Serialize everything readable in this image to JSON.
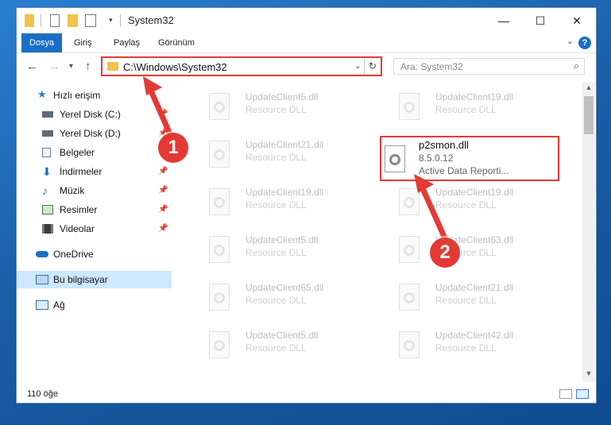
{
  "window": {
    "title": "System32",
    "controls": {
      "minimize": "—",
      "maximize": "☐",
      "close": "✕"
    }
  },
  "ribbon": {
    "tabs": [
      "Dosya",
      "Giriş",
      "Paylaş",
      "Görünüm"
    ],
    "active_tab": "Dosya",
    "help": "?"
  },
  "address": {
    "path": "C:\\Windows\\System32",
    "search_placeholder": "Ara: System32"
  },
  "nav": {
    "items": [
      {
        "label": "Hızlı erişim",
        "icon": "star-icon",
        "pinned": false
      },
      {
        "label": "Yerel Disk (C:)",
        "icon": "drive-icon",
        "pinned": true
      },
      {
        "label": "Yerel Disk (D:)",
        "icon": "drive-icon",
        "pinned": true
      },
      {
        "label": "Belgeler",
        "icon": "documents-icon",
        "pinned": true
      },
      {
        "label": "İndirmeler",
        "icon": "download-icon",
        "pinned": true
      },
      {
        "label": "Müzik",
        "icon": "music-icon",
        "pinned": true
      },
      {
        "label": "Resimler",
        "icon": "pictures-icon",
        "pinned": true
      },
      {
        "label": "Videolar",
        "icon": "videos-icon",
        "pinned": true
      },
      {
        "label": "OneDrive",
        "icon": "onedrive-icon",
        "pinned": false
      },
      {
        "label": "Bu bilgisayar",
        "icon": "computer-icon",
        "pinned": false,
        "selected": true
      },
      {
        "label": "Ağ",
        "icon": "network-icon",
        "pinned": false
      }
    ]
  },
  "files": {
    "left": [
      {
        "name": "UpdateClient5.dll",
        "desc": "Resource DLL"
      },
      {
        "name": "UpdateClient21.dll",
        "desc": "Resource DLL"
      },
      {
        "name": "UpdateClient19.dll",
        "desc": "Resource DLL"
      },
      {
        "name": "UpdateClient5.dll",
        "desc": "Resource DLL"
      },
      {
        "name": "UpdateClient65.dll",
        "desc": "Resource DLL"
      },
      {
        "name": "UpdateClient5.dll",
        "desc": "Resource DLL"
      }
    ],
    "right": [
      {
        "name": "UpdateClient19.dll",
        "desc": "Resource DLL"
      },
      null,
      {
        "name": "UpdateClient19.dll",
        "desc": "Resource DLL"
      },
      {
        "name": "UpdateClient63.dll",
        "desc": "Resource DLL"
      },
      {
        "name": "UpdateClient21.dll",
        "desc": "Resource DLL"
      },
      {
        "name": "UpdateClient42.dll",
        "desc": "Resource DLL"
      }
    ],
    "highlighted": {
      "name": "p2smon.dll",
      "version": "8.5.0.12",
      "desc": "Active Data Reporti..."
    }
  },
  "status": {
    "count": "110 öğe"
  },
  "annotations": {
    "badge1": "1",
    "badge2": "2",
    "color": "#e53935"
  }
}
